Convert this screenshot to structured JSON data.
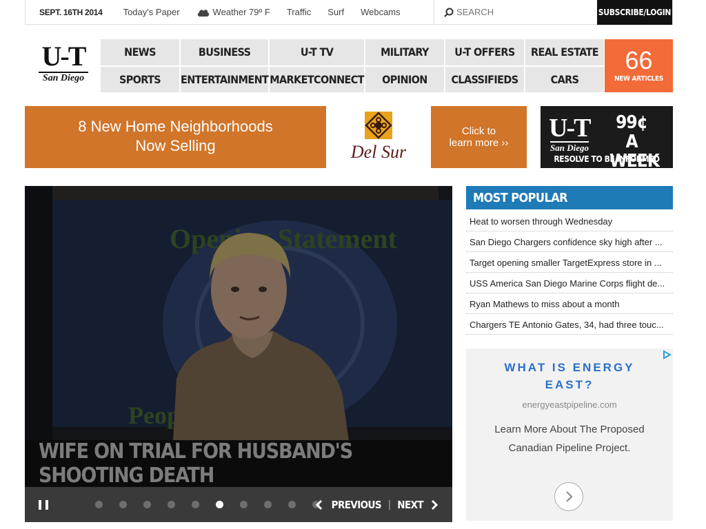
{
  "topbar": {
    "date": "SEPT. 16TH 2014",
    "links": [
      "Today's Paper",
      "Weather 79º F",
      "Traffic",
      "Surf",
      "Webcams"
    ],
    "search_placeholder": "SEARCH",
    "subscribe_label": "SUBSCRIBE/LOGIN"
  },
  "logo": {
    "line1": "U-T",
    "line2": "San Diego"
  },
  "nav": {
    "items": [
      "NEWS",
      "BUSINESS",
      "U-T TV",
      "MILITARY",
      "U-T OFFERS",
      "REAL ESTATE",
      "SPORTS",
      "ENTERTAINMENT",
      "MARKETCONNECT",
      "OPINION",
      "CLASSIFIEDS",
      "CARS"
    ],
    "new_articles_count": "66",
    "new_articles_label": "NEW ARTICLES"
  },
  "ad_banner": {
    "headline_line1": "8 New Home Neighborhoods",
    "headline_line2": "Now Selling",
    "brand": "Del Sur",
    "cta_line1": "Click to",
    "cta_line2": "learn more ››"
  },
  "ut_ad": {
    "line1": "U-T",
    "line2": "San Diego",
    "price": "99¢ A WEEK",
    "tagline": "RESOLVE TO BE INFORMED"
  },
  "hero": {
    "caption": "WIFE ON TRIAL FOR HUSBAND'S SHOOTING DEATH",
    "slide_count": 10,
    "active_slide": 6,
    "prev_label": "PREVIOUS",
    "next_label": "NEXT",
    "separator": "|"
  },
  "most_popular": {
    "title": "MOST POPULAR",
    "items": [
      "Heat to worsen through Wednesday",
      "San Diego Chargers confidence sky high after ...",
      "Target opening smaller TargetExpress store in ...",
      "USS America San Diego Marine Corps flight de...",
      "Ryan Mathews to miss about a month",
      "Chargers TE Antonio Gates, 34, had three touc..."
    ]
  },
  "side_ad": {
    "headline": "WHAT IS ENERGY EAST?",
    "url": "energyeastpipeline.com",
    "body": "Learn More About The Proposed Canadian Pipeline Project."
  },
  "colors": {
    "accent_orange": "#f26b38",
    "ad_orange": "#d0752a",
    "popular_blue": "#1f7ab8",
    "ad_headline_blue": "#2a6fc9"
  }
}
